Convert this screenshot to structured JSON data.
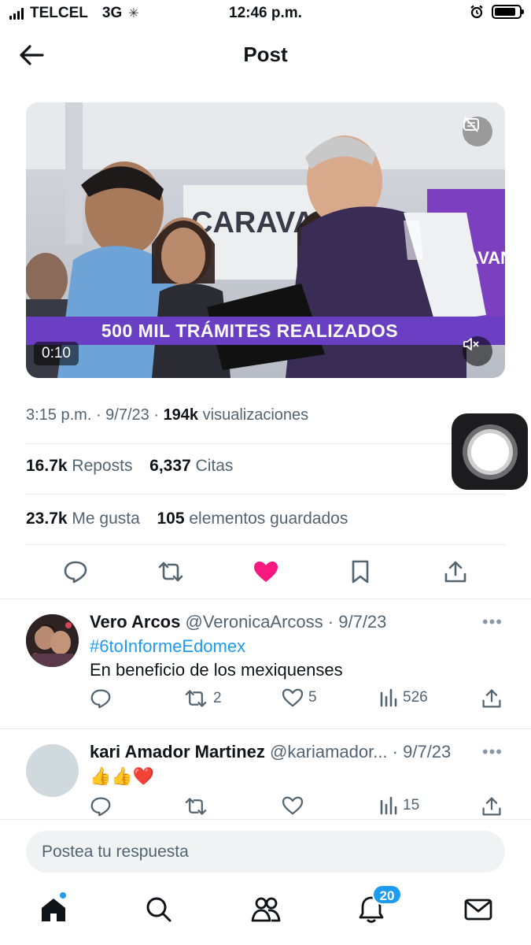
{
  "status_bar": {
    "carrier": "TELCEL",
    "network": "3G",
    "time": "12:46 p.m."
  },
  "header": {
    "title": "Post",
    "back_icon": "arrow-left-icon"
  },
  "media": {
    "banner_text": "500 MIL TRÁMITES REALIZADOS",
    "duration": "0:10",
    "background_sign": "CARAVAN",
    "colors": {
      "banner": "#6b3fc4",
      "accent_wall": "#7b3fc0"
    }
  },
  "post_meta": {
    "time": "3:15 p.m.",
    "date": "9/7/23",
    "views_count": "194k",
    "views_label": "visualizaciones"
  },
  "stats": {
    "reposts_count": "16.7k",
    "reposts_label": "Reposts",
    "quotes_count": "6,337",
    "quotes_label": "Citas",
    "likes_count": "23.7k",
    "likes_label": "Me gusta",
    "bookmarks_count": "105",
    "bookmarks_label": "elementos guardados"
  },
  "actions": {
    "icons": [
      "reply-icon",
      "retweet-icon",
      "heart-filled-icon",
      "bookmark-icon",
      "share-icon"
    ],
    "like_color": "#f91880"
  },
  "replies": [
    {
      "name": "Vero Arcos",
      "handle": "@VeronicaArcoss",
      "date": "9/7/23",
      "hashtag": "#6toInformeEdomex",
      "text": "En beneficio de los mexiquenses",
      "retweets": "2",
      "likes": "5",
      "views": "526"
    },
    {
      "name": "kari Amador Martinez",
      "handle": "@kariamador...",
      "date": "9/7/23",
      "text": "👍👍❤️",
      "retweets": "",
      "likes": "",
      "views": "15"
    }
  ],
  "composer": {
    "placeholder": "Postea tu respuesta"
  },
  "nav": {
    "tabs": [
      "home-icon",
      "search-icon",
      "communities-icon",
      "notifications-icon",
      "messages-icon"
    ],
    "notifications_badge": "20"
  },
  "colors": {
    "accent": "#1d9bf0",
    "text_primary": "#0f1419",
    "text_secondary": "#536471"
  }
}
